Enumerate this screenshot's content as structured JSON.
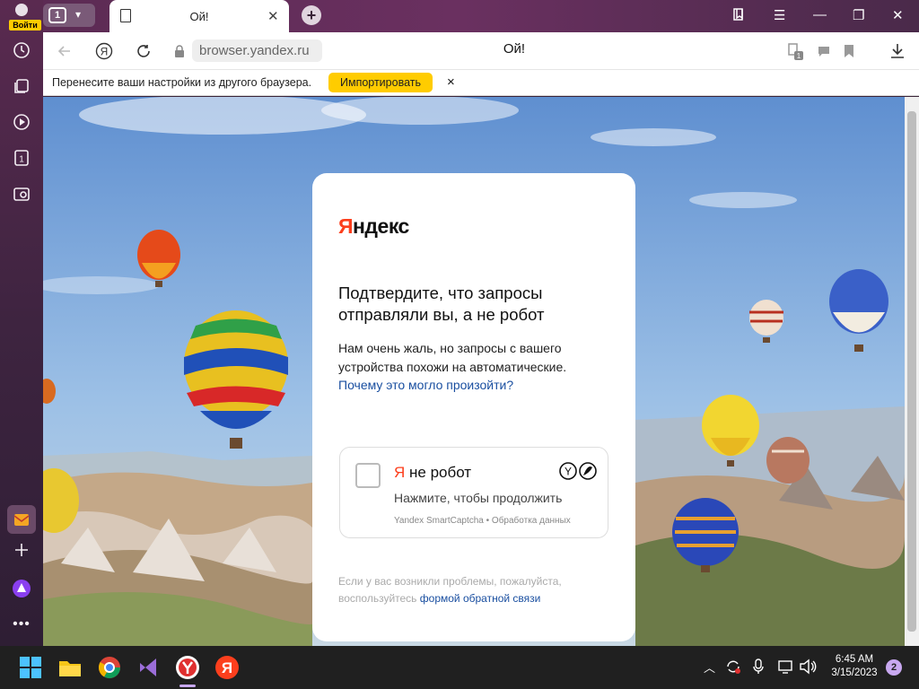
{
  "sidebar": {
    "login_label": "Войти",
    "tab_count": "1"
  },
  "tabs": {
    "group_count": "1",
    "active_title": "Ой!"
  },
  "toolbar": {
    "url": "browser.yandex.ru",
    "page_title": "Ой!",
    "shield_badge": "1"
  },
  "infobar": {
    "message": "Перенесите ваши настройки из другого браузера.",
    "import_label": "Импортировать",
    "close_label": "×"
  },
  "captcha": {
    "logo_ya": "Я",
    "logo_rest": "ндекс",
    "heading": "Подтвердите, что запросы отправляли вы, а не робот",
    "text": "Нам очень жаль, но запросы с вашего устройства похожи на автоматические.",
    "why_link": "Почему это могло произойти?",
    "checkbox_ya": "Я",
    "checkbox_label": " не робот",
    "checkbox_hint": "Нажмите, чтобы продолжить",
    "smartcaptcha": "Yandex SmartCaptcha • Обработка данных",
    "footer_text": "Если у вас возникли проблемы, пожалуйста, воспользуйтесь",
    "footer_link": "формой обратной связи"
  },
  "taskbar": {
    "time": "6:45 AM",
    "date": "3/15/2023",
    "notifications": "2"
  },
  "colors": {
    "yandex_red": "#fc3f1d",
    "import_yellow": "#ffcc00",
    "link_blue": "#1a4fa0"
  }
}
